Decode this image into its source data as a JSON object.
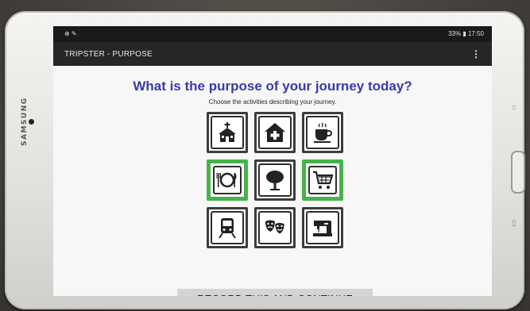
{
  "device": {
    "brand": "SAMSUNG"
  },
  "status_bar": {
    "left_icons": "⊕ ✎",
    "right_text": "33% ▮ 17:50"
  },
  "app_bar": {
    "title": "TRIPSTER - PURPOSE",
    "menu_icon": "⋮"
  },
  "main": {
    "heading": "What is the purpose of your journey today?",
    "subheading": "Choose the activities describing your journey.",
    "activities": [
      {
        "icon": "church-icon",
        "selected": false
      },
      {
        "icon": "hospital-icon",
        "selected": false
      },
      {
        "icon": "coffee-cup-icon",
        "selected": false
      },
      {
        "icon": "restaurant-icon",
        "selected": true
      },
      {
        "icon": "park-tree-icon",
        "selected": false
      },
      {
        "icon": "shopping-cart-icon",
        "selected": true
      },
      {
        "icon": "train-icon",
        "selected": false
      },
      {
        "icon": "theatre-masks-icon",
        "selected": false
      },
      {
        "icon": "sewing-machine-icon",
        "selected": false
      }
    ],
    "record_button": "RECORD THIS AND CONTINUE"
  },
  "colors": {
    "heading": "#3a3aa6",
    "selected_border": "#47b34a",
    "button_bg": "#d4d4d4",
    "app_bar": "#262626"
  }
}
